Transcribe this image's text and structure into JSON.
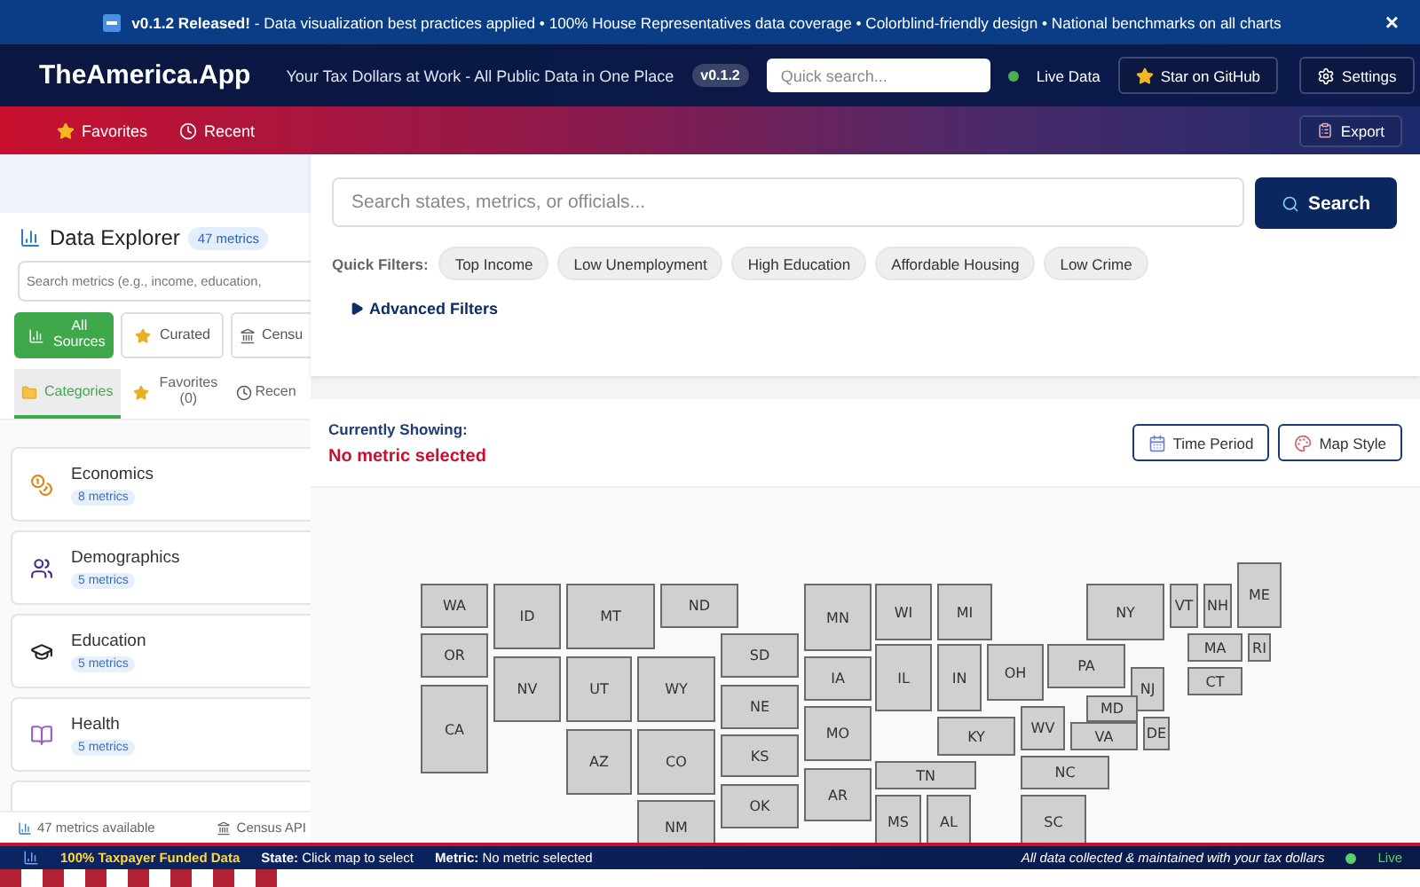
{
  "banner": {
    "text": "**v0.1.2 Released!** - Data visualization best practices applied • 100% House Representatives data coverage • Colorblind-friendly design • National benchmarks on all charts",
    "close": "×"
  },
  "header": {
    "title": "TheAmerica.App",
    "tagline": "Your Tax Dollars at Work - All Public Data in One Place",
    "version": "v0.1.2",
    "search": {
      "placeholder": "Quick search..."
    },
    "status": "Live Data",
    "buttons": [
      "Star on GitHub",
      "Settings"
    ]
  },
  "nav": {
    "items": [
      "Favorites",
      "Recent"
    ],
    "export": "Export"
  },
  "sidebar": {
    "title": "Data Explorer",
    "count": "47 metrics",
    "search": {
      "placeholder": "Search metrics (e.g., income, education,"
    },
    "sources": [
      {
        "label": "All Sources",
        "selected": true
      },
      {
        "label": "Curated",
        "selected": false
      },
      {
        "label": "Censu",
        "selected": false
      }
    ],
    "tabs": [
      {
        "label": "Categories",
        "selected": true
      },
      {
        "label": "Favorites (0)",
        "selected": false
      },
      {
        "label": "Recen",
        "selected": false
      }
    ],
    "categories": [
      {
        "name": "Economics",
        "count": "8 metrics"
      },
      {
        "name": "Demographics",
        "count": "5 metrics"
      },
      {
        "name": "Education",
        "count": "5 metrics"
      },
      {
        "name": "Health",
        "count": "5 metrics"
      }
    ],
    "footer": [
      "47 metrics available",
      "Census API"
    ]
  },
  "search_panel": {
    "search": {
      "placeholder": "Search states, metrics, or officials..."
    },
    "button": "Search",
    "filters_label": "Quick Filters:",
    "filters": [
      "Top Income",
      "Low Unemployment",
      "High Education",
      "Affordable Housing",
      "Low Crime"
    ],
    "advanced": {
      "label": "Advanced Filters",
      "expanded": false
    }
  },
  "current": {
    "label": "Currently Showing:",
    "value": "No metric selected",
    "buttons": [
      "Time Period",
      "Map Style"
    ]
  },
  "map": {
    "states": [
      "WA",
      "ID",
      "MT",
      "ND",
      "OR",
      "NV",
      "UT",
      "WY",
      "CA",
      "SD",
      "NE",
      "KS",
      "OK",
      "AZ",
      "CO",
      "NM",
      "MN",
      "IA",
      "MO",
      "AR",
      "WI",
      "MI",
      "IL",
      "IN",
      "OH",
      "KY",
      "TN",
      "MS",
      "AL",
      "WV",
      "VA",
      "NC",
      "SC",
      "PA",
      "NJ",
      "DE",
      "NY",
      "VT",
      "NH",
      "ME",
      "MA",
      "RI",
      "CT",
      "MD"
    ]
  },
  "status_bar": {
    "funded": "100% Taxpayer Funded Data",
    "state": "**State:** Click map to select",
    "metric": "**Metric:** No metric selected",
    "note": "All data collected & maintained with your tax dollars",
    "live": "Live"
  }
}
